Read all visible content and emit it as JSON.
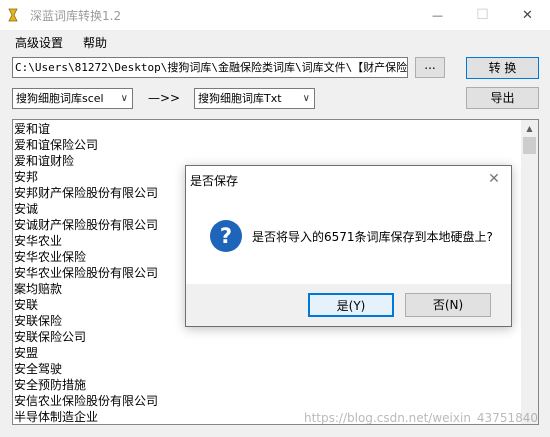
{
  "window": {
    "title": "深蓝词库转换1.2",
    "minimize": "—",
    "maximize": "☐",
    "close": "✕"
  },
  "menu": [
    {
      "label": "高级设置"
    },
    {
      "label": "帮助"
    }
  ],
  "path": {
    "value": "C:\\Users\\81272\\Desktop\\搜狗词库\\金融保险类词库\\词库文件\\【财产保险"
  },
  "browse_label": "...",
  "convert_label": "转 换",
  "export_label": "导出",
  "source_format": "搜狗细胞词库scel",
  "arrow_text": "—>>",
  "target_format": "搜狗细胞词库Txt",
  "words": [
    "爱和谊",
    "爱和谊保险公司",
    "爱和谊财险",
    "安邦",
    "安邦财产保险股份有限公司",
    "安诚",
    "安诚财产保险股份有限公司",
    "安华农业",
    "安华农业保险",
    "安华农业保险股份有限公司",
    "案均赔款",
    "安联",
    "安联保险",
    "安联保险公司",
    "安盟",
    "安全驾驶",
    "安全预防措施",
    "安信农业保险股份有限公司",
    "半导体制造企业"
  ],
  "dialog": {
    "title": "是否保存",
    "message": "是否将导入的6571条词库保存到本地硬盘上?",
    "yes_label": "是(Y)",
    "no_label": "否(N)",
    "icon": "question-icon"
  },
  "watermark": "https://blog.csdn.net/weixin_43751840"
}
